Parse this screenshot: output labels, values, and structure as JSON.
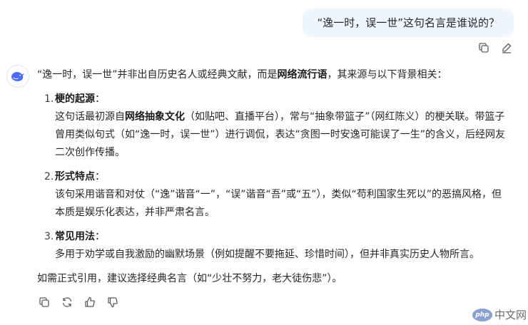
{
  "user_message": {
    "text": "“逸一时，误一世”这句名言是谁说的？"
  },
  "user_actions": {
    "copy_icon": "copy-icon",
    "edit_icon": "edit-icon"
  },
  "assistant": {
    "avatar_icon": "whale-logo-icon",
    "intro": {
      "pre": "“逸一时，误一世”并非出自历史名人或经典文献，而是",
      "bold": "网络流行语",
      "post": "，其来源与以下背景相关："
    },
    "items": [
      {
        "num": "1.",
        "title": "梗的起源",
        "colon": "：",
        "body_pre": "这句话最初源自",
        "body_bold": "网络抽象文化",
        "body_post": "（如贴吧、直播平台），常与“抽象带篮子”（网红陈义）的梗关联。带篮子曾用类似句式（如“逸一时，误一世”）进行调侃，表达“贪图一时安逸可能误了一生”的含义，后经网友二次创作传播。"
      },
      {
        "num": "2.",
        "title": "形式特点",
        "colon": "：",
        "body": "该句采用谐音和对仗（“逸”谐音“一”，“误”谐音“吾”或“五”），类似“苟利国家生死以”的恶搞风格，但本质是娱乐化表达，并非严肃名言。"
      },
      {
        "num": "3.",
        "title": "常见用法",
        "colon": "：",
        "body": "多用于劝学或自我激励的幽默场景（例如提醒不要拖延、珍惜时间），但并非真实历史人物所言。"
      }
    ],
    "closing": "如需正式引用，建议选择经典名言（如“少壮不努力，老大徒伤悲”）。"
  },
  "bot_actions": {
    "copy_icon": "copy-icon",
    "regenerate_icon": "refresh-icon",
    "like_icon": "thumbs-up-icon",
    "dislike_icon": "thumbs-down-icon"
  },
  "watermark": {
    "logo_text": "php",
    "text": "中文网"
  },
  "colors": {
    "user_bubble": "#eff6ff",
    "icon": "#5c5c5c",
    "brand": "#4d6bfe"
  }
}
